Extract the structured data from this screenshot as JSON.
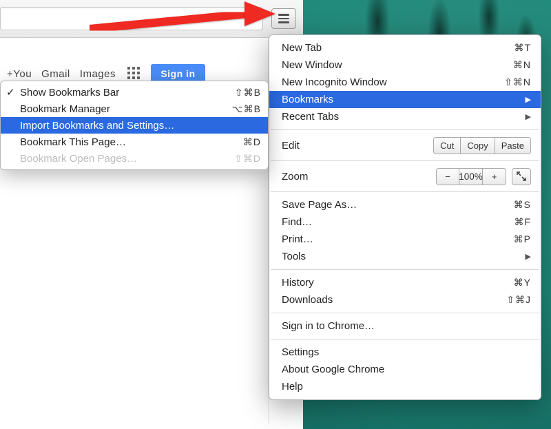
{
  "toolbar": {
    "omnibox_value": ""
  },
  "page": {
    "link_you": "+You",
    "link_gmail": "Gmail",
    "link_images": "Images",
    "signin_label": "Sign in"
  },
  "menu": {
    "new_tab": "New Tab",
    "sc_new_tab": "⌘T",
    "new_window": "New Window",
    "sc_new_window": "⌘N",
    "new_incognito": "New Incognito Window",
    "sc_new_incognito": "⇧⌘N",
    "bookmarks": "Bookmarks",
    "recent_tabs": "Recent Tabs",
    "edit": "Edit",
    "cut": "Cut",
    "copy": "Copy",
    "paste": "Paste",
    "zoom": "Zoom",
    "zoom_pct": "100%",
    "save_page": "Save Page As…",
    "sc_save_page": "⌘S",
    "find": "Find…",
    "sc_find": "⌘F",
    "print": "Print…",
    "sc_print": "⌘P",
    "tools": "Tools",
    "history": "History",
    "sc_history": "⌘Y",
    "downloads": "Downloads",
    "sc_downloads": "⇧⌘J",
    "signin_chrome": "Sign in to Chrome…",
    "settings": "Settings",
    "about": "About Google Chrome",
    "help": "Help"
  },
  "submenu": {
    "show_bar": "Show Bookmarks Bar",
    "sc_show_bar": "⇧⌘B",
    "manager": "Bookmark Manager",
    "sc_manager": "⌥⌘B",
    "import": "Import Bookmarks and Settings…",
    "this_page": "Bookmark This Page…",
    "sc_this_page": "⌘D",
    "open_pages": "Bookmark Open Pages…",
    "sc_open_pages": "⇧⌘D"
  }
}
